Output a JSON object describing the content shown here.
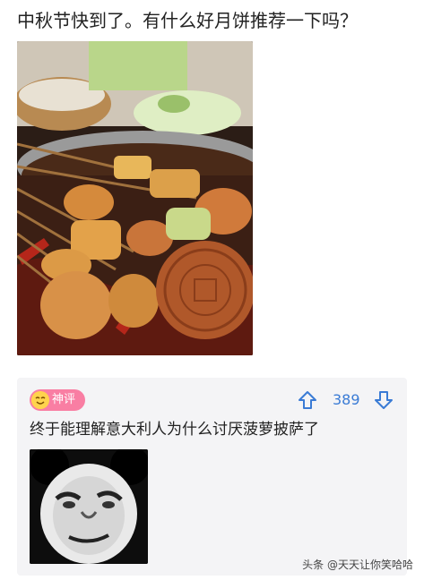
{
  "post": {
    "title": "中秋节快到了。有什么好月饼推荐一下吗？",
    "image_icon": "mooncake-skewers-hotpot-photo"
  },
  "comment": {
    "badge_label": "神评",
    "badge_icon": "smile-emoji-icon",
    "vote_count": "389",
    "text": "终于能理解意大利人为什么讨厌菠萝披萨了",
    "meme_icon": "panda-face-meme",
    "colors": {
      "badge": "#f97ea3",
      "vote": "#3a7bd5",
      "card": "#f4f4f6"
    }
  },
  "watermark": "头条 @天天让你笑哈哈"
}
